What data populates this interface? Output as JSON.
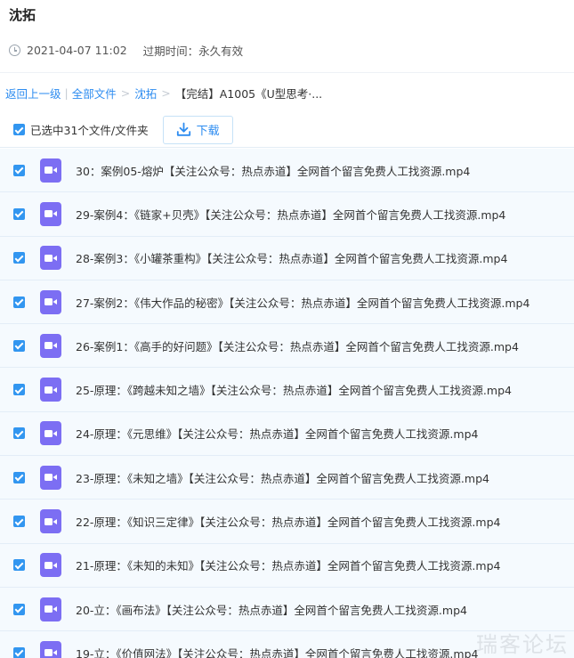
{
  "share": {
    "sharer_name": "沈拓",
    "date": "2021-04-07 11:02",
    "expire_label": "过期时间：",
    "expire_value": "永久有效"
  },
  "breadcrumb": {
    "back": "返回上一级",
    "all_files": "全部文件",
    "folder": "沈拓",
    "current": "【完结】A1005《U型思考·..."
  },
  "toolbar": {
    "selected_text": "已选中31个文件/文件夹",
    "download_label": "下载"
  },
  "colors": {
    "accent": "#2d8cf0",
    "checkbox": "#3296f0",
    "video_icon": "#7c6ef3"
  },
  "icons": {
    "file": "video-file-icon",
    "clock": "clock-icon",
    "download": "download-icon"
  },
  "files": [
    {
      "name": "30：案例05-熔炉【关注公众号：热点赤道】全网首个留言免费人工找资源.mp4",
      "checked": true
    },
    {
      "name": "29-案例4：《链家+贝壳》【关注公众号：热点赤道】全网首个留言免费人工找资源.mp4",
      "checked": true
    },
    {
      "name": "28-案例3：《小罐茶重构》【关注公众号：热点赤道】全网首个留言免费人工找资源.mp4",
      "checked": true
    },
    {
      "name": "27-案例2：《伟大作品的秘密》【关注公众号：热点赤道】全网首个留言免费人工找资源.mp4",
      "checked": true
    },
    {
      "name": "26-案例1：《高手的好问题》【关注公众号：热点赤道】全网首个留言免费人工找资源.mp4",
      "checked": true
    },
    {
      "name": "25-原理：《跨越未知之墙》【关注公众号：热点赤道】全网首个留言免费人工找资源.mp4",
      "checked": true
    },
    {
      "name": "24-原理：《元思维》【关注公众号：热点赤道】全网首个留言免费人工找资源.mp4",
      "checked": true
    },
    {
      "name": "23-原理：《未知之墙》【关注公众号：热点赤道】全网首个留言免费人工找资源.mp4",
      "checked": true
    },
    {
      "name": "22-原理：《知识三定律》【关注公众号：热点赤道】全网首个留言免费人工找资源.mp4",
      "checked": true
    },
    {
      "name": "21-原理：《未知的未知》【关注公众号：热点赤道】全网首个留言免费人工找资源.mp4",
      "checked": true
    },
    {
      "name": "20-立：《画布法》【关注公众号：热点赤道】全网首个留言免费人工找资源.mp4",
      "checked": true
    },
    {
      "name": "19-立：《价值网法》【关注公众号：热点赤道】全网首个留言免费人工找资源.mp4",
      "checked": true
    }
  ],
  "watermark": "瑞客论坛"
}
